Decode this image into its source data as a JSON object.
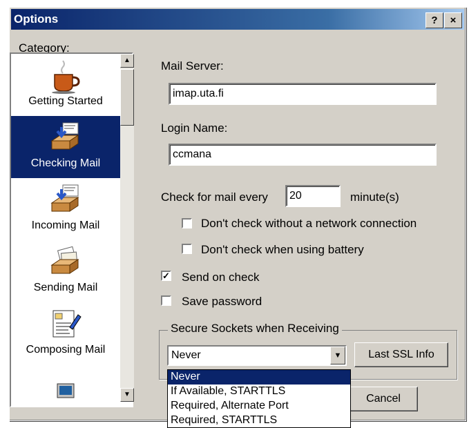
{
  "window": {
    "title": "Options",
    "help_label": "?",
    "close_label": "×"
  },
  "category": {
    "label": "Category:",
    "items": [
      {
        "label": "Getting Started",
        "icon": "coffee-cup-icon",
        "selected": false
      },
      {
        "label": "Checking Mail",
        "icon": "inbox-tray-icon",
        "selected": true
      },
      {
        "label": "Incoming Mail",
        "icon": "inbox-tray-icon",
        "selected": false
      },
      {
        "label": "Sending Mail",
        "icon": "outbox-tray-icon",
        "selected": false
      },
      {
        "label": "Composing Mail",
        "icon": "compose-document-icon",
        "selected": false
      }
    ]
  },
  "form": {
    "mail_server_label": "Mail Server:",
    "mail_server_value": "imap.uta.fi",
    "login_name_label": "Login Name:",
    "login_name_value": "ccmana",
    "check_every_label": "Check for mail every",
    "check_every_value": "20",
    "minutes_label": "minute(s)",
    "no_network_label": "Don't check without a network connection",
    "no_network_checked": false,
    "battery_label": "Don't check when using battery",
    "battery_checked": false,
    "send_on_check_label": "Send on check",
    "send_on_check_checked": true,
    "save_password_label": "Save password",
    "save_password_checked": false
  },
  "ssl": {
    "group_label": "Secure Sockets when Receiving",
    "selected": "Never",
    "options": [
      "Never",
      "If Available, STARTTLS",
      "Required, Alternate Port",
      "Required, STARTTLS"
    ],
    "last_ssl_info_label": "Last SSL Info"
  },
  "buttons": {
    "cancel_label": "Cancel"
  },
  "colors": {
    "titlebar": "#0a246a",
    "selection": "#0a246a",
    "face": "#d4d0c8"
  }
}
